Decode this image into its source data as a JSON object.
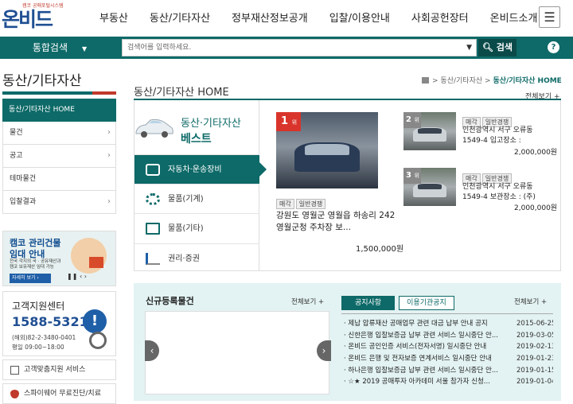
{
  "brand": {
    "logo": "온비드",
    "tagline": "캠코 공매포털시스템"
  },
  "gnb": [
    "부동산",
    "동산/기타자산",
    "정부재산정보공개",
    "입찰/이용안내",
    "사회공헌장터",
    "온비드소개"
  ],
  "search": {
    "scope": "통합검색",
    "placeholder": "검색어를 입력하세요.",
    "button": "검색",
    "help": "?"
  },
  "lnb": {
    "title": "동산/기타자산",
    "items": [
      {
        "label": "동산/기타자산 HOME"
      },
      {
        "label": "물건",
        "arrow": "›"
      },
      {
        "label": "공고",
        "arrow": "›"
      },
      {
        "label": "테마물건"
      },
      {
        "label": "입찰결과",
        "arrow": "›"
      }
    ]
  },
  "banner": {
    "line1": "캠코 관리건물",
    "line2": "임대 안내",
    "line3": "전국 각지의 국 · 공유재산과",
    "line4": "캠코 보유재산 임대 가능",
    "more": "자세히 보기 ›",
    "controls": "❚❚ ‹ ›"
  },
  "cs": {
    "title": "고객지원센터",
    "tel": "1588-5321",
    "fax": "(해외)82-2-3480-0401",
    "hours": "평일 09:00~18:00"
  },
  "services": [
    "고객맞춤지원 서비스",
    "스파이웨어 무료진단/치료"
  ],
  "page": {
    "title": "동산/기타자산 HOME",
    "more": "전체보기 +"
  },
  "breadcrumb": {
    "items": [
      "동산/기타자산"
    ],
    "current": "동산/기타자산 HOME",
    "sep": ">"
  },
  "best": {
    "title1": "동산·기타자산",
    "title2": "베스트",
    "categories": [
      "자동차·운송장비",
      "물품(기계)",
      "물품(기타)",
      "권리·증권"
    ],
    "items": [
      {
        "rank": "1",
        "rank_suffix": "위",
        "tags": [
          "매각",
          "일반경쟁"
        ],
        "desc": "강원도 영월군 영월읍 하송리 242 영월군청 주차장 보...",
        "price": "1,500,000원"
      },
      {
        "rank": "2",
        "rank_suffix": "위",
        "tags": [
          "매각",
          "일반경쟁"
        ],
        "desc1": "인천광역시 서구 오류동",
        "desc2": "1549-4 입고장소 :",
        "price": "2,000,000원"
      },
      {
        "rank": "3",
        "rank_suffix": "위",
        "tags": [
          "매각",
          "일반경쟁"
        ],
        "desc1": "인천광역시 서구 오류동",
        "desc2": "1549-4 보관장소 : (주)",
        "price": "2,000,000원"
      }
    ]
  },
  "newlist": {
    "title": "신규등록물건",
    "more": "전체보기 +",
    "prev": "‹",
    "next": "›"
  },
  "notice": {
    "tabs": [
      "공지사항",
      "이용기관공지"
    ],
    "more": "전체보기 +",
    "rows": [
      {
        "title": "· 제납 압류재산 공매업무 관련 대금 납부 안내 공지",
        "date": "2015-06-25"
      },
      {
        "title": "· 신한은행 입찰보증금 납부 관련 서비스 일시중단 안...",
        "date": "2019-03-05"
      },
      {
        "title": "· 온비드 공인인증 서비스(전자서명) 일시중단 안내",
        "date": "2019-02-13"
      },
      {
        "title": "· 온비드 은행 및 전자보증 연계서비스 일시중단 안내",
        "date": "2019-01-23"
      },
      {
        "title": "· 하나은행 입찰보증금 납부 관련 서비스 일시중단 안...",
        "date": "2019-01-15"
      },
      {
        "title": "· ☆★ 2019 공매투자 아카데미 서울 참가자 신청...",
        "date": "2019-01-04"
      }
    ]
  }
}
